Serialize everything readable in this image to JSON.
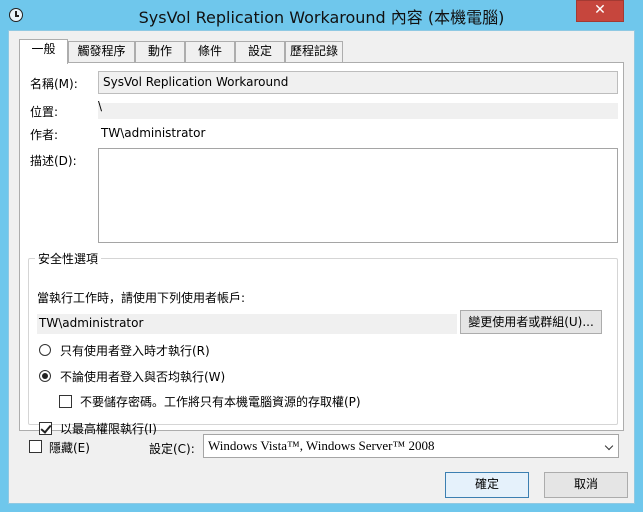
{
  "window": {
    "title": "SysVol Replication Workaround 內容 (本機電腦)",
    "close_glyph": "✕"
  },
  "tabs": [
    {
      "label": "一般",
      "active": true
    },
    {
      "label": "觸發程序",
      "active": false
    },
    {
      "label": "動作",
      "active": false
    },
    {
      "label": "條件",
      "active": false
    },
    {
      "label": "設定",
      "active": false
    },
    {
      "label": "歷程記錄",
      "active": false
    }
  ],
  "general": {
    "name_label": "名稱(M):",
    "name_value": "SysVol Replication Workaround",
    "location_label": "位置:",
    "location_value": "\\",
    "author_label": "作者:",
    "author_value": "TW\\administrator",
    "description_label": "描述(D):",
    "description_value": ""
  },
  "security": {
    "legend": "安全性選項",
    "prompt": "當執行工作時，請使用下列使用者帳戶:",
    "account": "TW\\administrator",
    "change_user_button": "變更使用者或群組(U)...",
    "radio_logged_on": "只有使用者登入時才執行(R)",
    "radio_whether": "不論使用者登入與否均執行(W)",
    "no_store_password": "不要儲存密碼。工作將只有本機電腦資源的存取權(P)",
    "highest_privileges": "以最高權限執行(I)",
    "selected_radio": "whether",
    "no_store_checked": false,
    "highest_checked": true
  },
  "footer": {
    "hidden_label": "隱藏(E)",
    "hidden_checked": false,
    "configure_label": "設定(C):",
    "configure_value": "Windows Vista™, Windows Server™ 2008",
    "ok_button": "確定",
    "cancel_button": "取消"
  }
}
